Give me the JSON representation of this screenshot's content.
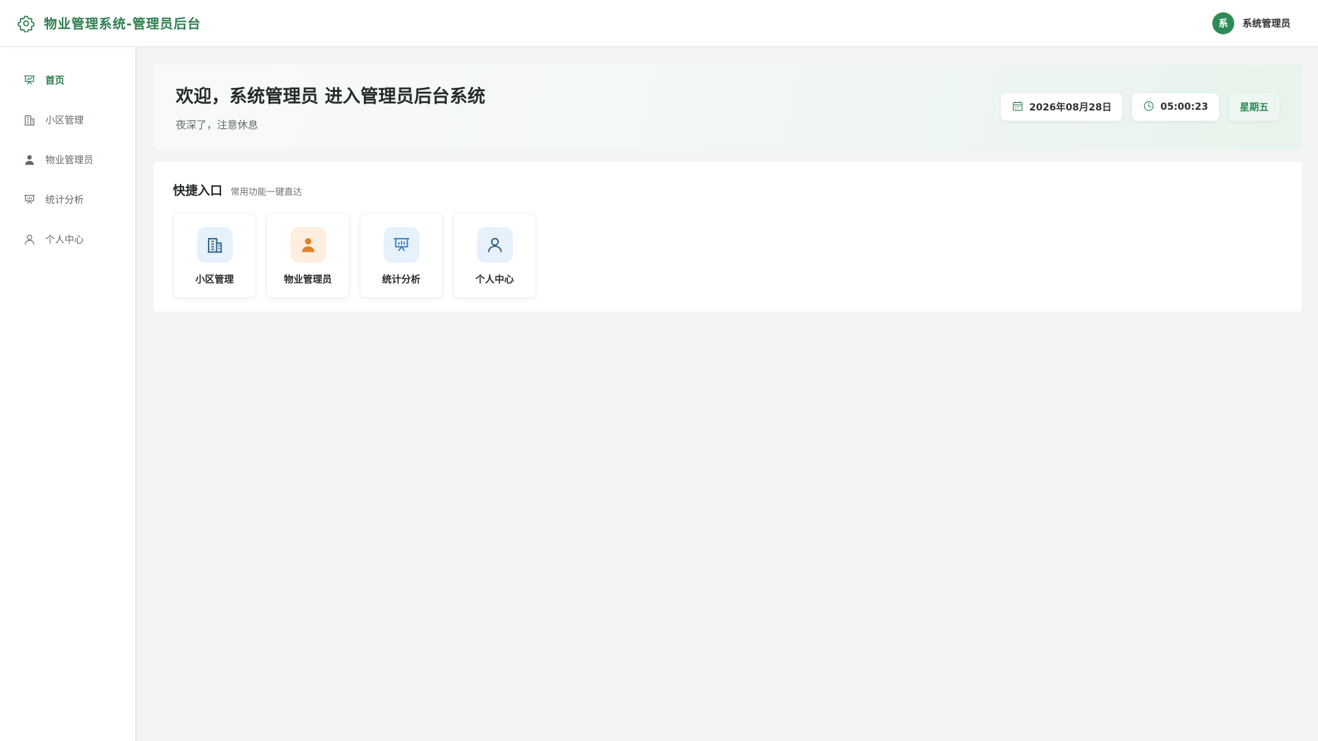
{
  "header": {
    "title": "物业管理系统-管理员后台",
    "logo_icon": "gear-icon",
    "user": {
      "avatar_text": "系",
      "name": "系统管理员"
    }
  },
  "sidebar": {
    "items": [
      {
        "label": "首页",
        "icon": "presentation-icon",
        "active": true
      },
      {
        "label": "小区管理",
        "icon": "building-icon",
        "active": false
      },
      {
        "label": "物业管理员",
        "icon": "user-filled-icon",
        "active": false
      },
      {
        "label": "统计分析",
        "icon": "presentation-chart-icon",
        "active": false
      },
      {
        "label": "个人中心",
        "icon": "user-outline-icon",
        "active": false
      }
    ]
  },
  "welcome": {
    "title": "欢迎，系统管理员 进入管理员后台系统",
    "subtitle": "夜深了，注意休息",
    "date": "2026年08月28日",
    "time": "05:00:23",
    "weekday": "星期五"
  },
  "quick": {
    "title": "快捷入口",
    "subtitle": "常用功能一键直达",
    "items": [
      {
        "label": "小区管理",
        "icon": "building-icon",
        "bg": "#e6f1fb",
        "color": "#2f5f8a"
      },
      {
        "label": "物业管理员",
        "icon": "user-filled-icon",
        "bg": "#fdeede",
        "color": "#e0832b"
      },
      {
        "label": "统计分析",
        "icon": "presentation-chart-icon",
        "bg": "#e6f1fb",
        "color": "#3a7fc0"
      },
      {
        "label": "个人中心",
        "icon": "user-outline-icon",
        "bg": "#e6f1fb",
        "color": "#2f5f8a"
      }
    ]
  },
  "colors": {
    "brand": "#2e7d4f",
    "accent": "#2e8b57",
    "page_bg": "#f3f5f4"
  }
}
